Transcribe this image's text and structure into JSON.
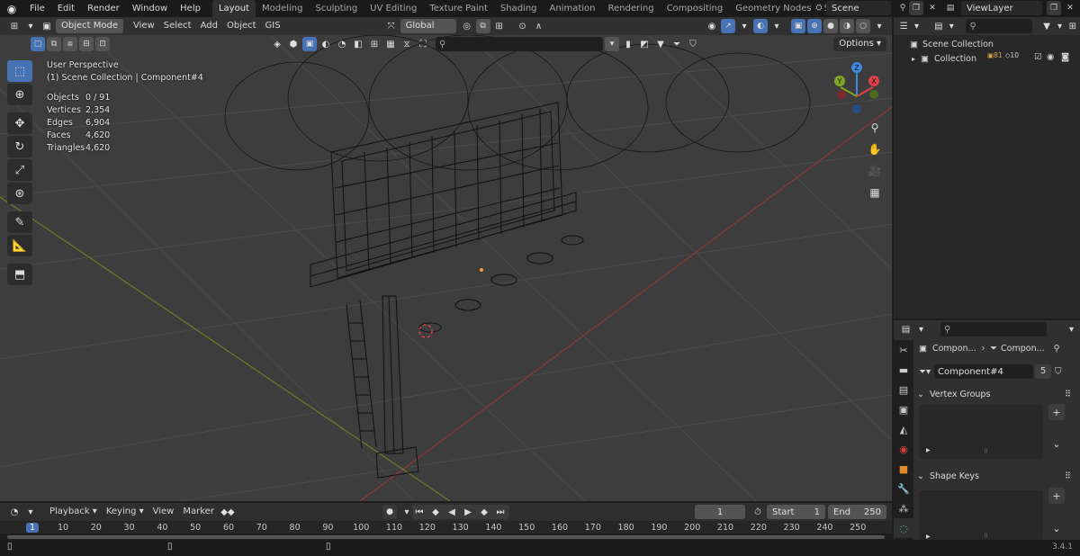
{
  "topbar": {
    "menu": [
      "File",
      "Edit",
      "Render",
      "Window",
      "Help"
    ],
    "workspaces": [
      "Layout",
      "Modeling",
      "Sculpting",
      "UV Editing",
      "Texture Paint",
      "Shading",
      "Animation",
      "Rendering",
      "Compositing",
      "Geometry Nodes",
      "Scripting"
    ],
    "active_workspace": "Layout",
    "scene": "Scene",
    "view_layer": "ViewLayer"
  },
  "viewport_header": {
    "mode": "Object Mode",
    "menus": [
      "View",
      "Select",
      "Add",
      "Object",
      "GIS"
    ],
    "transform_orientation": "Global",
    "options_label": "Options"
  },
  "viewport_overlay": {
    "perspective": "User Perspective",
    "context": "(1) Scene Collection | Component#4",
    "stats": [
      {
        "label": "Objects",
        "value": "0 / 91"
      },
      {
        "label": "Vertices",
        "value": "2,354"
      },
      {
        "label": "Edges",
        "value": "6,904"
      },
      {
        "label": "Faces",
        "value": "4,620"
      },
      {
        "label": "Triangles",
        "value": "4,620"
      }
    ]
  },
  "gizmo": {
    "x": "X",
    "y": "Y",
    "z": "Z"
  },
  "outliner": {
    "root": "Scene Collection",
    "collection": "Collection",
    "badge_a": "81",
    "badge_b": "10"
  },
  "properties": {
    "breadcrumb_a": "Compon...",
    "breadcrumb_b": "Compon...",
    "datablock_name": "Component#4",
    "user_count": "5",
    "panel_vertex_groups": "Vertex Groups",
    "panel_shape_keys": "Shape Keys"
  },
  "timeline": {
    "menus": [
      "Playback",
      "Keying",
      "View",
      "Marker"
    ],
    "current_frame": "1",
    "start_label": "Start",
    "start_value": "1",
    "end_label": "End",
    "end_value": "250",
    "ruler_ticks": [
      "1",
      "10",
      "20",
      "30",
      "40",
      "50",
      "60",
      "70",
      "80",
      "90",
      "100",
      "110",
      "120",
      "130",
      "140",
      "150",
      "160",
      "170",
      "180",
      "190",
      "200",
      "210",
      "220",
      "230",
      "240",
      "250"
    ]
  },
  "statusbar": {
    "version": "3.4.1"
  },
  "colors": {
    "accent": "#4772b3",
    "viewport_bg": "#3d3d3d",
    "axis_x": "#e0424a",
    "axis_y": "#7fa61e",
    "axis_z": "#3d8ae0"
  }
}
